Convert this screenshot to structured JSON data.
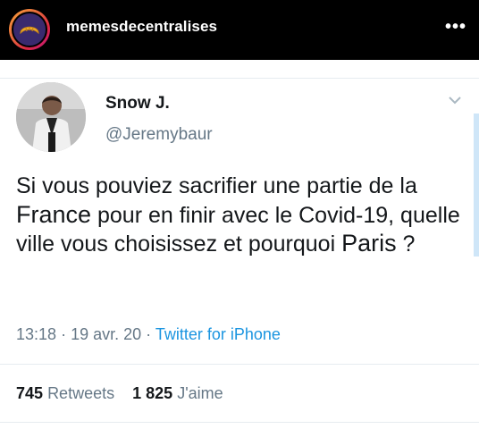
{
  "instagram": {
    "username": "memesdecentralises",
    "more_label": "•••",
    "avatar_icon": "croissant-icon"
  },
  "tweet": {
    "display_name": "Snow J.",
    "handle": "@Jeremybaur",
    "text_parts": {
      "p1": "Si vous pouviez sacrifier une partie de la ",
      "france": "France",
      "p2": "  pour en finir avec le Covid-19, quelle ville vous choisissez et pourquoi ",
      "paris": "Paris",
      "p3": " ?"
    },
    "time": "13:18",
    "date": "19 avr. 20",
    "separator": "·",
    "source": "Twitter for iPhone",
    "retweets_count": "745",
    "retweets_label": "Retweets",
    "likes_count": "1 825",
    "likes_label": "J'aime",
    "menu_icon": "chevron-down-icon"
  },
  "colors": {
    "header_bg": "#000000",
    "text_primary": "#14171a",
    "text_secondary": "#657786",
    "link": "#1b95e0"
  }
}
